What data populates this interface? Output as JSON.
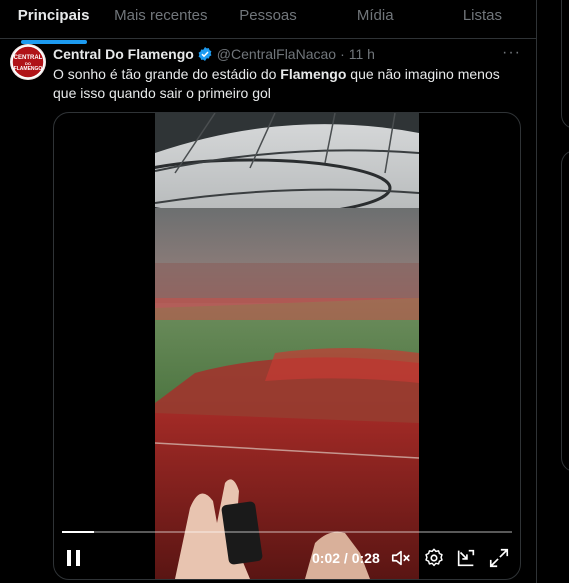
{
  "tabs": [
    {
      "label": "Principais",
      "active": true
    },
    {
      "label": "Mais recentes",
      "active": false
    },
    {
      "label": "Pessoas",
      "active": false
    },
    {
      "label": "Mídia",
      "active": false
    },
    {
      "label": "Listas",
      "active": false
    }
  ],
  "tweet": {
    "author_name": "Central Do Flamengo",
    "handle": "@CentralFlaNacao",
    "separator": "·",
    "time": "11 h",
    "text_part1": "O sonho é tão grande do estádio do ",
    "text_bold": "Flamengo",
    "text_part2": " que não imagino menos que isso quando sair o primeiro gol",
    "avatar_lines": [
      "CENTRAL",
      "DO",
      "FLAMENGO"
    ]
  },
  "video": {
    "current_time": "0:02",
    "duration": "0:28",
    "timecode_separator": " / ",
    "progress_fraction": 0.07,
    "state": "playing"
  },
  "icons": {
    "verified": "verified-badge-icon",
    "more": "more-options-icon",
    "pause": "pause-icon",
    "mute": "volume-muted-icon",
    "settings": "settings-gear-icon",
    "pip": "picture-in-picture-icon",
    "fullscreen": "fullscreen-icon"
  },
  "colors": {
    "accent": "#1d9bf0",
    "background": "#000000",
    "secondary_text": "#71767b",
    "crowd_red": "#c41a1f"
  }
}
